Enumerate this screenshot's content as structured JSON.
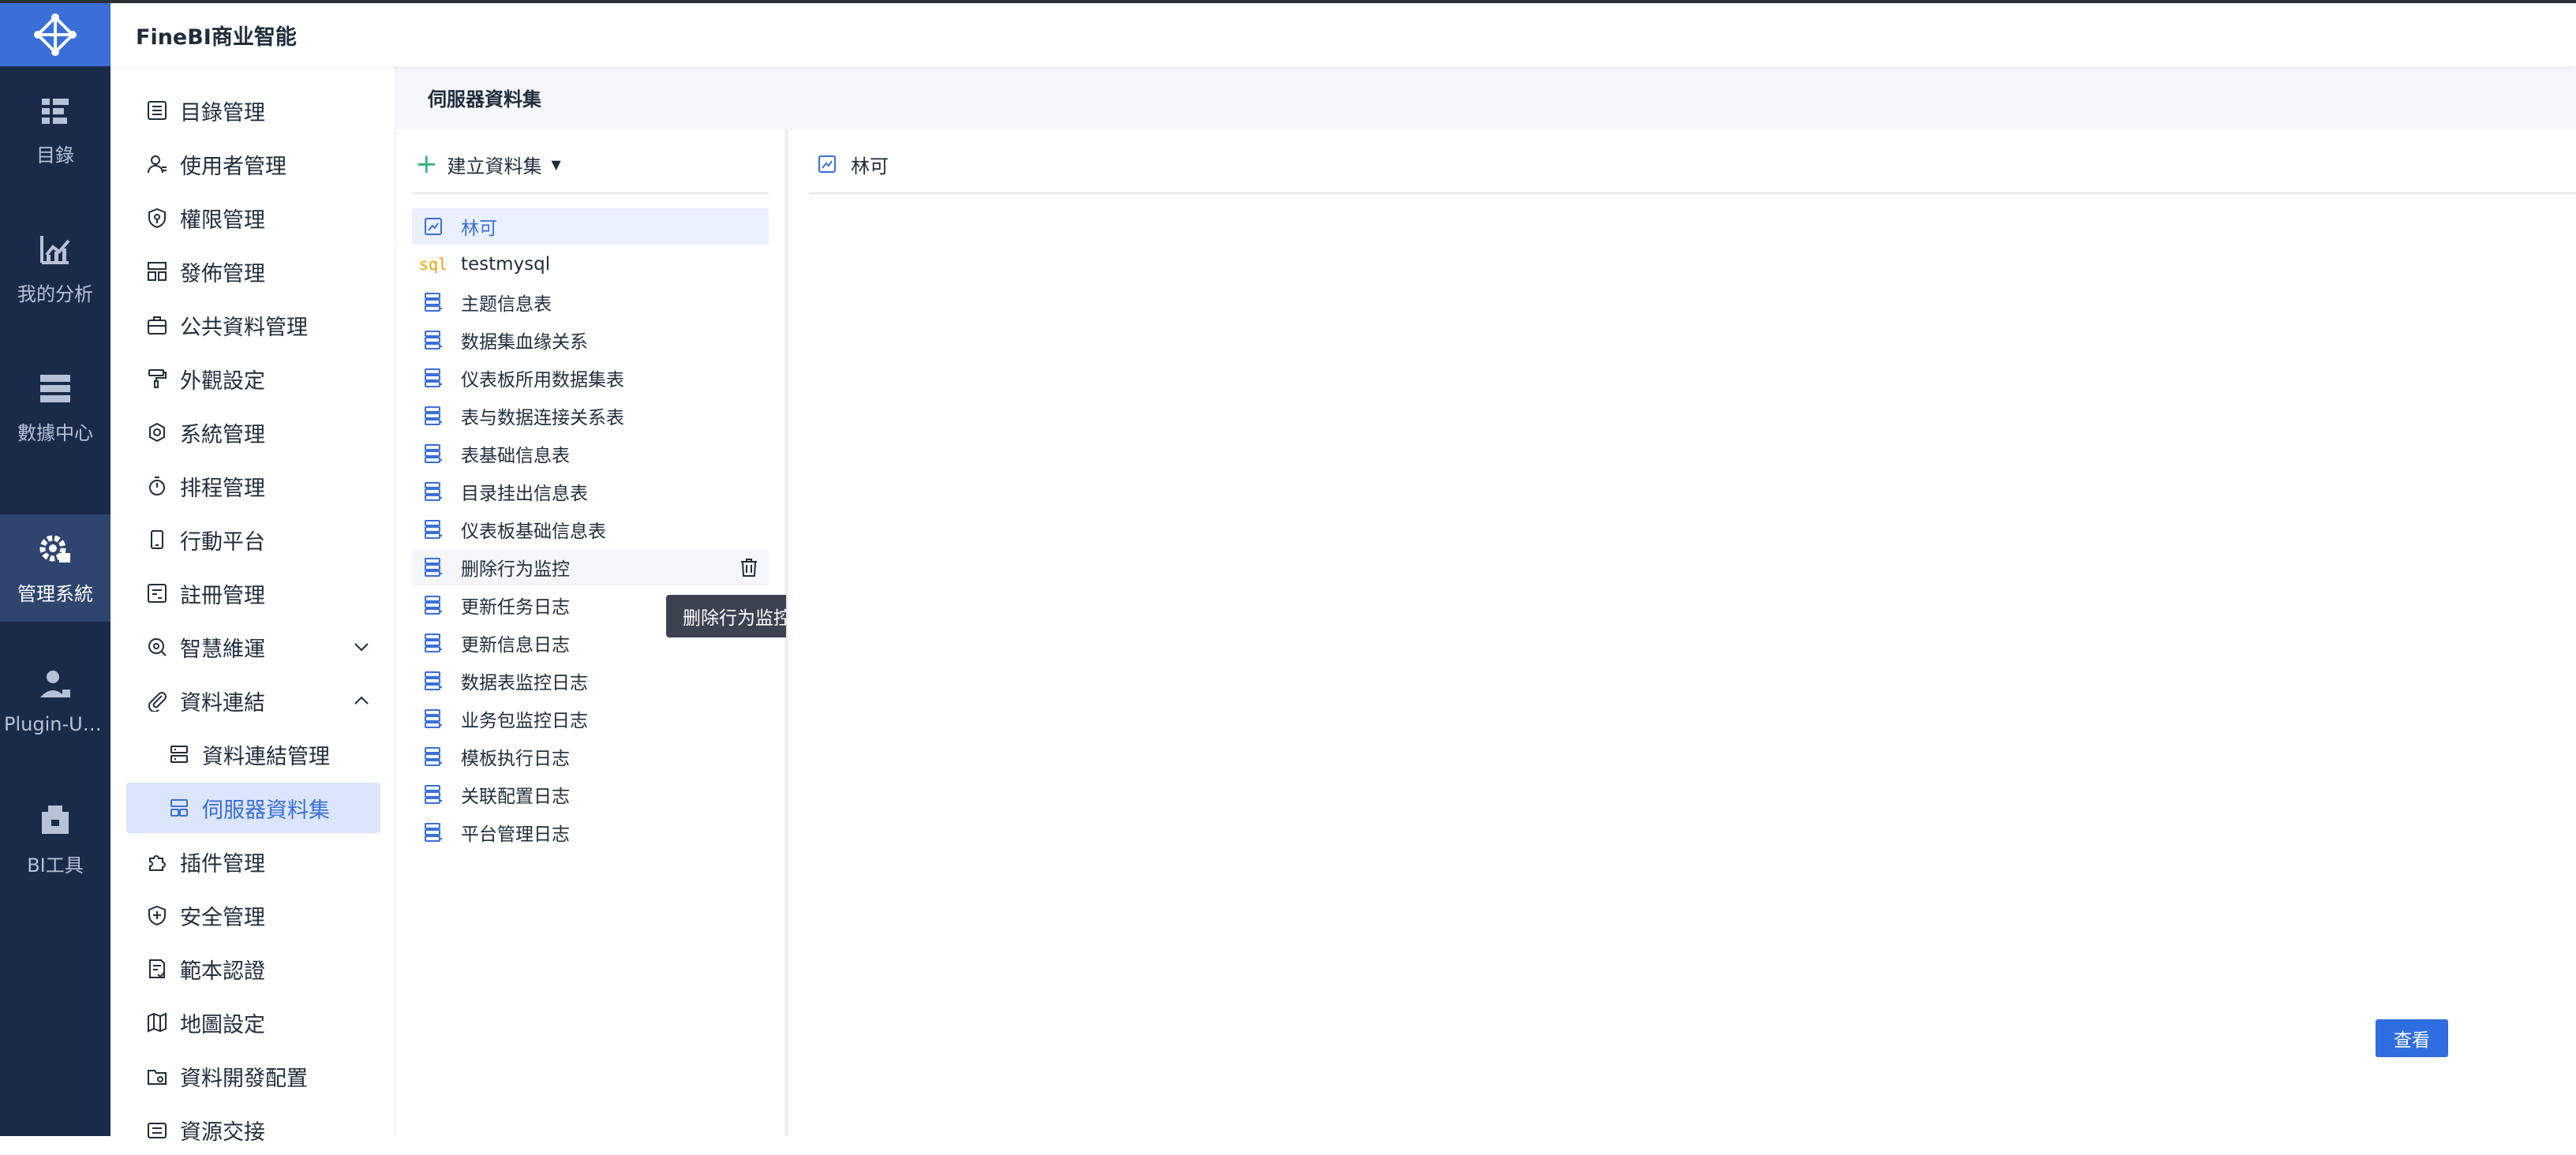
{
  "header": {
    "title": "FineBI商业智能"
  },
  "rail": {
    "items": [
      {
        "label": "目錄",
        "icon": "catalog-icon"
      },
      {
        "label": "我的分析",
        "icon": "analysis-chart-icon"
      },
      {
        "label": "數據中心",
        "icon": "data-center-icon"
      },
      {
        "label": "管理系統",
        "icon": "admin-gear-icon"
      },
      {
        "label": "Plugin-Us...",
        "icon": "plugin-user-icon"
      },
      {
        "label": "BI工具",
        "icon": "toolbox-icon"
      }
    ]
  },
  "nav": {
    "items": [
      {
        "label": "目錄管理",
        "icon": "list-icon"
      },
      {
        "label": "使用者管理",
        "icon": "user-icon"
      },
      {
        "label": "權限管理",
        "icon": "permission-icon"
      },
      {
        "label": "發佈管理",
        "icon": "publish-icon"
      },
      {
        "label": "公共資料管理",
        "icon": "briefcase-icon"
      },
      {
        "label": "外觀設定",
        "icon": "paint-roller-icon"
      },
      {
        "label": "系統管理",
        "icon": "settings-icon"
      },
      {
        "label": "排程管理",
        "icon": "timer-icon"
      },
      {
        "label": "行動平台",
        "icon": "mobile-icon"
      },
      {
        "label": "註冊管理",
        "icon": "register-icon"
      },
      {
        "label": "智慧維運",
        "icon": "ops-icon"
      },
      {
        "label": "資料連結",
        "icon": "paperclip-icon"
      },
      {
        "label": "資料連結管理",
        "icon": "connection-icon"
      },
      {
        "label": "伺服器資料集",
        "icon": "server-dataset-icon"
      },
      {
        "label": "插件管理",
        "icon": "puzzle-icon"
      },
      {
        "label": "安全管理",
        "icon": "shield-icon"
      },
      {
        "label": "範本認證",
        "icon": "template-cert-icon"
      },
      {
        "label": "地圖設定",
        "icon": "map-icon"
      },
      {
        "label": "資料開發配置",
        "icon": "folder-settings-icon"
      },
      {
        "label": "資源交接",
        "icon": "handover-icon"
      }
    ]
  },
  "content": {
    "breadcrumb": "伺服器資料集"
  },
  "dataset_list": {
    "create_label": "建立資料集",
    "items": [
      "林可",
      "testmysql",
      "主题信息表",
      "数据集血缘关系",
      "仪表板所用数据集表",
      "表与数据连接关系表",
      "表基础信息表",
      "目录挂出信息表",
      "仪表板基础信息表",
      "删除行为监控",
      "更新任务日志",
      "更新信息日志",
      "数据表监控日志",
      "业务包监控日志",
      "模板执行日志",
      "关联配置日志",
      "平台管理日志"
    ],
    "sql_icon_text": "sql"
  },
  "tooltip": {
    "text": "删除行为监控"
  },
  "detail": {
    "title": "林可",
    "view_button": "查看"
  },
  "colors": {
    "rail_bg": "#1a2b4a",
    "accent": "#3a6fd8",
    "button": "#2f6ee0"
  }
}
